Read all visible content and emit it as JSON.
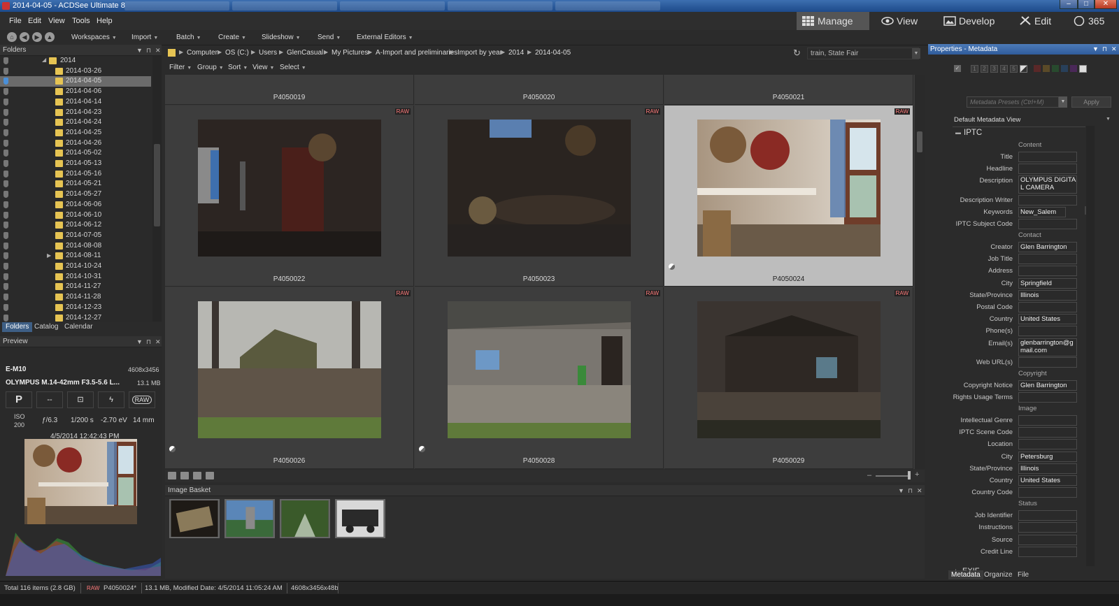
{
  "window": {
    "title": "2014-04-05 - ACDSee Ultimate 8",
    "minimize": "–",
    "maximize": "□",
    "close": "✕"
  },
  "menubar": {
    "items": [
      "File",
      "Edit",
      "View",
      "Tools",
      "Help"
    ],
    "modes": [
      "Manage",
      "View",
      "Develop",
      "Edit",
      "365"
    ]
  },
  "toolbar": {
    "items": [
      "Workspaces",
      "Import",
      "Batch",
      "Create",
      "Slideshow",
      "Send",
      "External Editors"
    ]
  },
  "folders": {
    "title": "Folders",
    "parent": "2014",
    "items": [
      "2014-03-26",
      "2014-04-05",
      "2014-04-06",
      "2014-04-14",
      "2014-04-23",
      "2014-04-24",
      "2014-04-25",
      "2014-04-26",
      "2014-05-02",
      "2014-05-13",
      "2014-05-16",
      "2014-05-21",
      "2014-05-27",
      "2014-06-06",
      "2014-06-10",
      "2014-06-12",
      "2014-07-05",
      "2014-08-08",
      "2014-08-11",
      "2014-10-24",
      "2014-10-31",
      "2014-11-27",
      "2014-11-28",
      "2014-12-23",
      "2014-12-27"
    ],
    "selected": "2014-04-05",
    "tabs": [
      "Folders",
      "Catalog",
      "Calendar"
    ]
  },
  "preview": {
    "title": "Preview",
    "camera": "E-M10",
    "dimensions": "4608x3456",
    "lens": "OLYMPUS M.14-42mm F3.5-5.6 L...",
    "filesize": "13.1 MB",
    "mode": "P",
    "metering": "--",
    "raw": "RAW",
    "iso_label": "ISO",
    "iso": "200",
    "aperture": "ƒ/6.3",
    "shutter": "1/200 s",
    "ev": "-2.70 eV",
    "focal": "14 mm",
    "datetime": "4/5/2014 12:42:43 PM"
  },
  "breadcrumb": {
    "items": [
      "Computer",
      "OS (C:)",
      "Users",
      "GlenCasual",
      "My Pictures",
      "A-Import and preliminaries",
      "Import by year",
      "2014",
      "2014-04-05"
    ],
    "search_value": "train, State Fair"
  },
  "filterbar": {
    "items": [
      "Filter",
      "Group",
      "Sort",
      "View",
      "Select"
    ]
  },
  "grid": {
    "top_labels": [
      "P4050019",
      "P4050020",
      "P4050021"
    ],
    "rows": [
      [
        "P4050022",
        "P4050023",
        "P4050024"
      ],
      [
        "P4050026",
        "P4050028",
        "P4050029"
      ]
    ],
    "selected": "P4050024",
    "badge": "RAW"
  },
  "basket": {
    "title": "Image Basket"
  },
  "properties": {
    "title": "Properties - Metadata",
    "preset_placeholder": "Metadata Presets (Ctrl+M)",
    "apply": "Apply",
    "view_name": "Default Metadata View",
    "iptc_section": "IPTC",
    "exif_section": "EXIF",
    "rating_numbers": [
      "1",
      "2",
      "3",
      "4",
      "5"
    ],
    "fields": [
      {
        "section": "Content"
      },
      {
        "label": "Title",
        "value": ""
      },
      {
        "label": "Headline",
        "value": ""
      },
      {
        "label": "Description",
        "value": "OLYMPUS DIGITAL CAMERA"
      },
      {
        "label": "Description Writer",
        "value": ""
      },
      {
        "label": "Keywords",
        "value": "New_Salem"
      },
      {
        "label": "IPTC Subject Code",
        "value": ""
      },
      {
        "section": "Contact"
      },
      {
        "label": "Creator",
        "value": "Glen Barrington"
      },
      {
        "label": "Job Title",
        "value": ""
      },
      {
        "label": "Address",
        "value": ""
      },
      {
        "label": "City",
        "value": "Springfield"
      },
      {
        "label": "State/Province",
        "value": "Illinois"
      },
      {
        "label": "Postal Code",
        "value": ""
      },
      {
        "label": "Country",
        "value": "United States"
      },
      {
        "label": "Phone(s)",
        "value": ""
      },
      {
        "label": "Email(s)",
        "value": "glenbarrington@gmail.com"
      },
      {
        "label": "Web URL(s)",
        "value": ""
      },
      {
        "section": "Copyright"
      },
      {
        "label": "Copyright Notice",
        "value": "Glen Barrington"
      },
      {
        "label": "Rights Usage Terms",
        "value": ""
      },
      {
        "section": "Image"
      },
      {
        "label": "Intellectual Genre",
        "value": ""
      },
      {
        "label": "IPTC Scene Code",
        "value": ""
      },
      {
        "label": "Location",
        "value": ""
      },
      {
        "label": "City",
        "value": "Petersburg"
      },
      {
        "label": "State/Province",
        "value": "Illinois"
      },
      {
        "label": "Country",
        "value": "United States"
      },
      {
        "label": "Country Code",
        "value": ""
      },
      {
        "section": "Status"
      },
      {
        "label": "Job Identifier",
        "value": ""
      },
      {
        "label": "Instructions",
        "value": ""
      },
      {
        "label": "Source",
        "value": ""
      },
      {
        "label": "Credit Line",
        "value": ""
      }
    ],
    "tabs": [
      "Metadata",
      "Organize",
      "File"
    ]
  },
  "statusbar": {
    "total": "Total 116 items  (2.8 GB)",
    "raw": "RAW",
    "filename": "P4050024*",
    "modified": "13.1 MB, Modified Date: 4/5/2014 11:05:24 AM",
    "dims": "4608x3456x48b"
  },
  "colors": {
    "accent": "#3e5f85",
    "raw_badge": "#ff7a7a",
    "folder": "#e6c453",
    "selection": "#bdbdbd"
  }
}
